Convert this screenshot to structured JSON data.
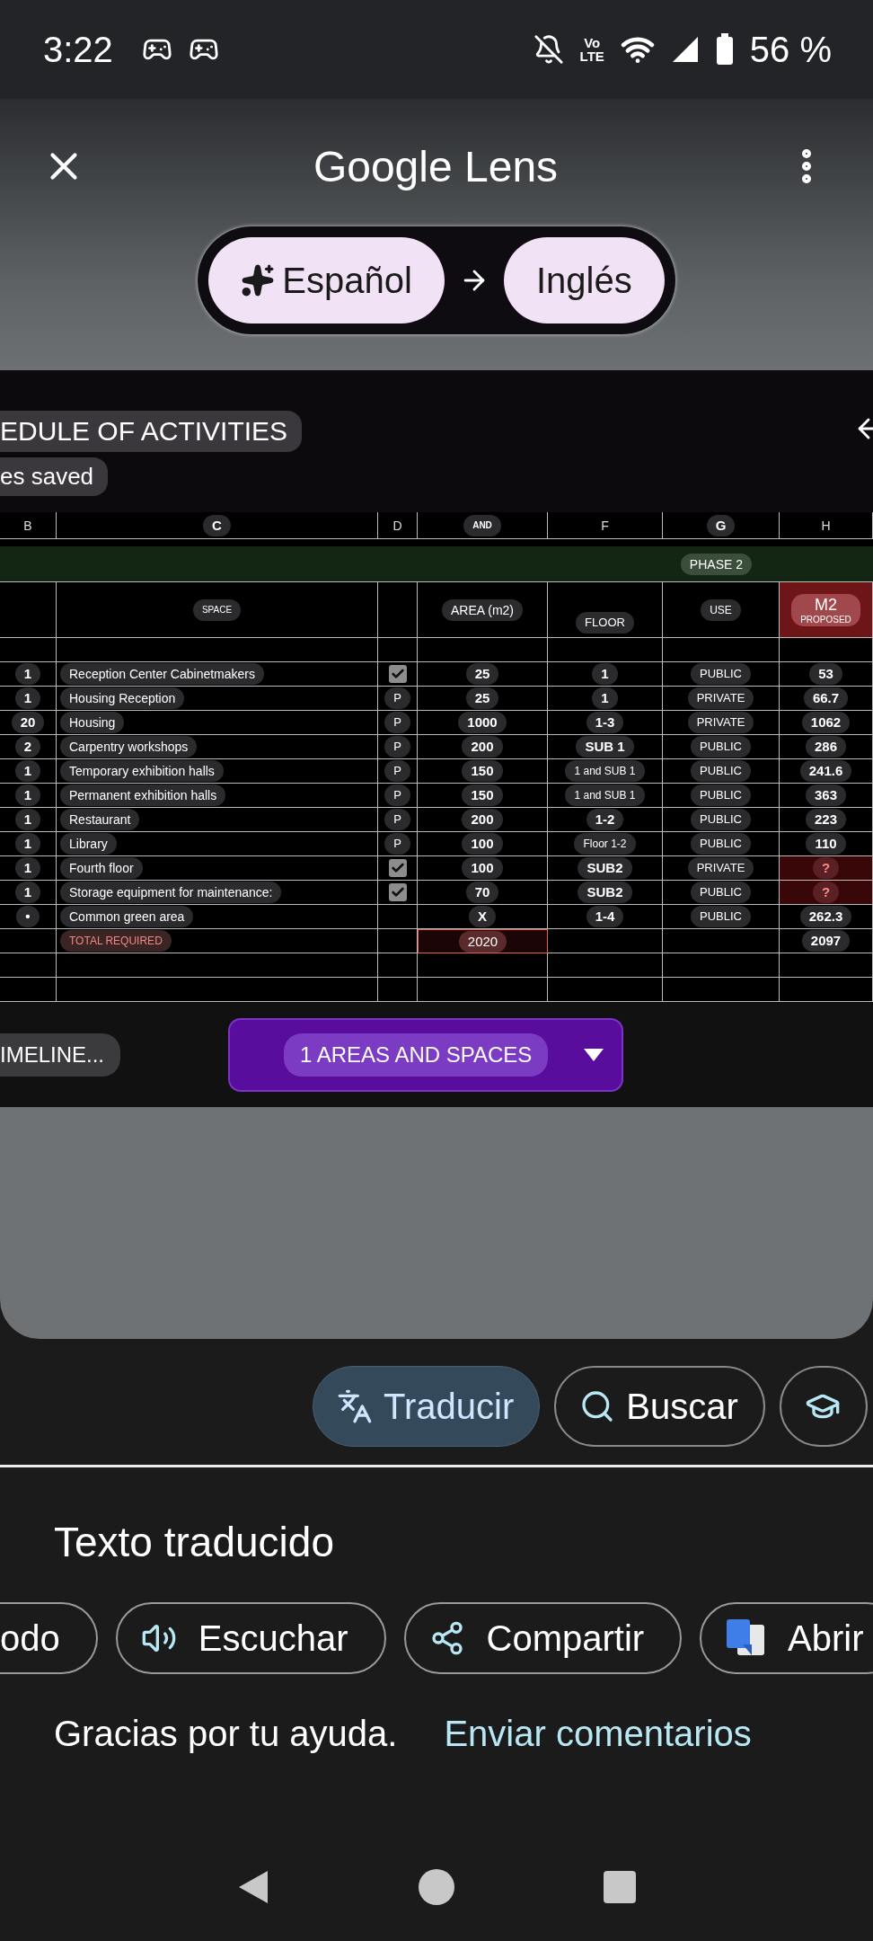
{
  "status_bar": {
    "time": "3:22",
    "network": [
      "Vo",
      "LTE"
    ],
    "battery": "56 %"
  },
  "header": {
    "title": "Google Lens"
  },
  "languages": {
    "source": "Español",
    "target": "Inglés"
  },
  "sheet": {
    "title": "EDULE OF ACTIVITIES",
    "save_state": "es saved",
    "columns": [
      {
        "label": "B",
        "overlay": false
      },
      {
        "label": "C",
        "overlay": true
      },
      {
        "label": "D",
        "overlay": false
      },
      {
        "label": "AND",
        "overlay": true
      },
      {
        "label": "F",
        "overlay": false
      },
      {
        "label": "G",
        "overlay": true
      },
      {
        "label": "H",
        "overlay": false
      }
    ],
    "phase": "PHASE 2",
    "headers": {
      "space": "SPACE",
      "area": "AREA (m2)",
      "floor": "FLOOR",
      "use": "USE",
      "m2": "M2",
      "m2_note": "PROPOSED"
    },
    "rows": [
      {
        "qty": "1",
        "space": "Reception Center Cabinetmakers",
        "d": {
          "kind": "check",
          "checked": true
        },
        "area": "25",
        "floor": "1",
        "use": "PUBLIC",
        "m2": "53",
        "alert": false
      },
      {
        "qty": "1",
        "space": "Housing Reception",
        "d": {
          "kind": "text",
          "text": "P"
        },
        "area": "25",
        "floor": "1",
        "use": "PRIVATE",
        "m2": "66.7",
        "alert": false
      },
      {
        "qty": "20",
        "space": "Housing",
        "d": {
          "kind": "text",
          "text": "P"
        },
        "area": "1000",
        "floor": "1-3",
        "use": "PRIVATE",
        "m2": "1062",
        "alert": false
      },
      {
        "qty": "2",
        "space": "Carpentry workshops",
        "d": {
          "kind": "text",
          "text": "P"
        },
        "area": "200",
        "floor": "SUB 1",
        "use": "PUBLIC",
        "m2": "286",
        "alert": false
      },
      {
        "qty": "1",
        "space": "Temporary exhibition halls",
        "d": {
          "kind": "text",
          "text": "P"
        },
        "area": "150",
        "floor": "1 and SUB 1",
        "use": "PUBLIC",
        "m2": "241.6",
        "alert": false
      },
      {
        "qty": "1",
        "space": "Permanent exhibition halls",
        "d": {
          "kind": "text",
          "text": "P"
        },
        "area": "150",
        "floor": "1 and SUB 1",
        "use": "PUBLIC",
        "m2": "363",
        "alert": false
      },
      {
        "qty": "1",
        "space": "Restaurant",
        "d": {
          "kind": "text",
          "text": "P"
        },
        "area": "200",
        "floor": "1-2",
        "use": "PUBLIC",
        "m2": "223",
        "alert": false
      },
      {
        "qty": "1",
        "space": "Library",
        "d": {
          "kind": "text",
          "text": "P"
        },
        "area": "100",
        "floor": "Floor 1-2",
        "use": "PUBLIC",
        "m2": "110",
        "alert": false
      },
      {
        "qty": "1",
        "space": "Fourth floor",
        "d": {
          "kind": "check",
          "checked": true
        },
        "area": "100",
        "floor": "SUB2",
        "use": "PRIVATE",
        "m2": "?",
        "alert": true
      },
      {
        "qty": "1",
        "space": "Storage equipment for maintenance:",
        "d": {
          "kind": "check",
          "checked": true
        },
        "area": "70",
        "floor": "SUB2",
        "use": "PUBLIC",
        "m2": "?",
        "alert": true
      },
      {
        "qty": "•",
        "space": "Common green area",
        "area": "X",
        "floor": "1-4",
        "use": "PUBLIC",
        "m2": "262.3",
        "alert": false
      }
    ],
    "total": {
      "label": "TOTAL REQUIRED",
      "area": "2020",
      "m2": "2097"
    },
    "tabs": [
      {
        "label": "IMELINE...",
        "selected": false
      },
      {
        "label": "1 AREAS AND SPACES",
        "selected": true
      }
    ]
  },
  "modes": [
    {
      "label": "Traducir",
      "kind": "translate",
      "selected": true
    },
    {
      "label": "Buscar",
      "kind": "search",
      "selected": false
    },
    {
      "kind": "school",
      "selected": false
    }
  ],
  "result": {
    "heading": "Texto traducido",
    "actions": [
      {
        "label": "odo",
        "kind": "cut"
      },
      {
        "label": "Escuchar",
        "kind": "listen"
      },
      {
        "label": "Compartir",
        "kind": "share"
      },
      {
        "label": "Abrir",
        "kind": "translate-app"
      }
    ],
    "thanks": "Gracias por tu ayuda.",
    "feedback": "Enviar comentarios"
  }
}
